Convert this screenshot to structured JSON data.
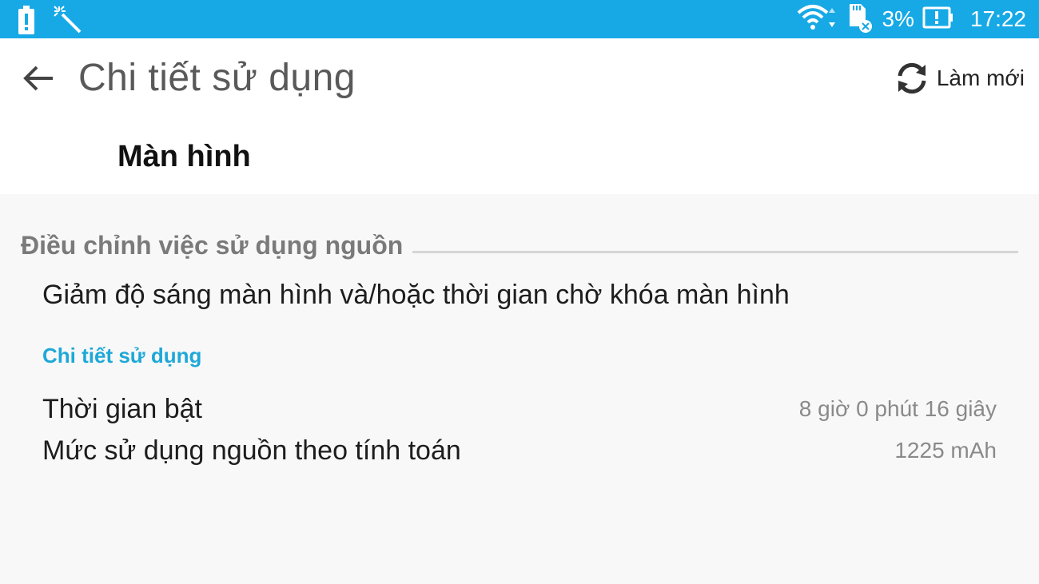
{
  "status_bar": {
    "left_icons": [
      "battery-alert-icon",
      "magic-wand-icon"
    ],
    "right_icons": [
      "wifi-icon",
      "sd-card-icon",
      "battery-low-icon"
    ],
    "battery_percent": "3%",
    "time": "17:22",
    "background_color": "#16a9e6"
  },
  "app_bar": {
    "title": "Chi tiết sử dụng",
    "refresh_label": "Làm mới"
  },
  "component": {
    "name": "Màn hình"
  },
  "section": {
    "title": "Điều chỉnh việc sử dụng nguồn",
    "tip": "Giảm độ sáng màn hình và/hoặc thời gian chờ khóa màn hình"
  },
  "usage": {
    "subheader": "Chi tiết sử dụng",
    "rows": [
      {
        "label": "Thời gian bật",
        "value": "8 giờ 0 phút 16 giây"
      },
      {
        "label": "Mức sử dụng nguồn theo tính toán",
        "value": "1225 mAh"
      }
    ],
    "accent_color": "#1ea8d8"
  }
}
